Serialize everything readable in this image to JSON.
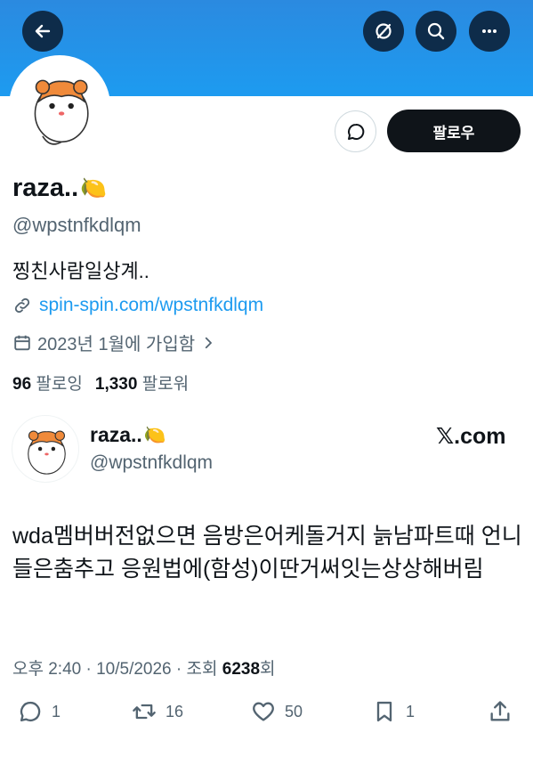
{
  "profile": {
    "display_name": "raza..",
    "emoji": "🍋",
    "handle": "@wpstnfkdlqm",
    "bio": "찡친사람일상계..",
    "link": "spin-spin.com/wpstnfkdlqm",
    "joined": "2023년 1월에 가입함",
    "following_count": "96",
    "following_label": "팔로잉",
    "followers_count": "1,330",
    "followers_label": "팔로워",
    "follow_button": "팔로우"
  },
  "post": {
    "display_name": "raza..",
    "emoji": "🍋",
    "handle": "@wpstnfkdlqm",
    "brand": "𝕏.com",
    "text": "wda멤버버전없으면 음방은어케돌거지 늙남파트때 언니들은춤추고 응원법에(함성)이딴거써잇는상상해버림",
    "time": "오후 2:40 · 10/5/2026 · 조회",
    "views": "6238",
    "views_suffix": "회",
    "replies": "1",
    "reposts": "16",
    "likes": "50",
    "bookmarks": "1"
  },
  "colors": {
    "banner": "#1d9bf0",
    "link": "#1d9bf0",
    "text_secondary": "#536471"
  },
  "icons": [
    "back-arrow-icon",
    "grok-icon",
    "search-icon",
    "more-icon",
    "message-icon",
    "link-icon",
    "calendar-icon",
    "chevron-right-icon",
    "reply-icon",
    "repost-icon",
    "like-icon",
    "bookmark-icon",
    "share-icon"
  ]
}
